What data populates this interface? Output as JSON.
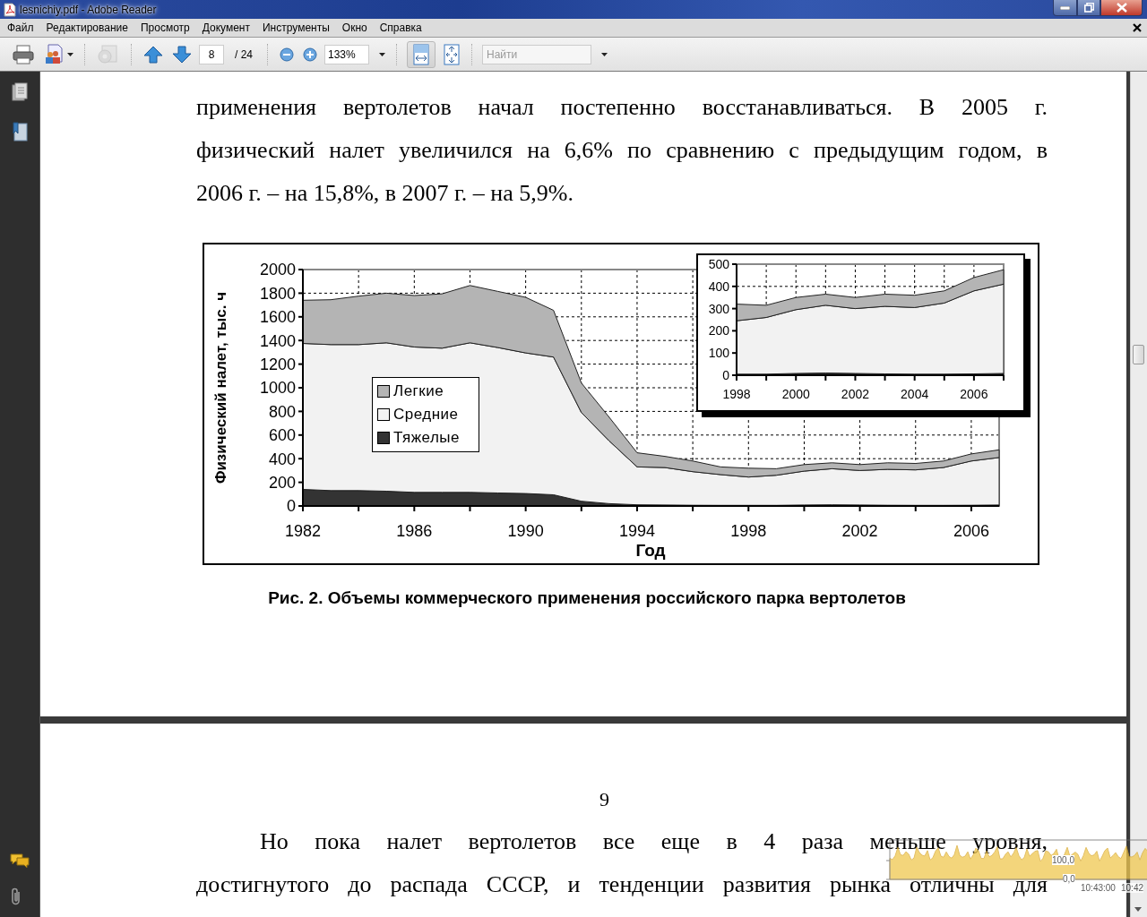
{
  "window": {
    "title": "lesnichiy.pdf - Adobe Reader"
  },
  "menu": [
    "Файл",
    "Редактирование",
    "Просмотр",
    "Документ",
    "Инструменты",
    "Окно",
    "Справка"
  ],
  "toolbar": {
    "items": [
      {
        "kind": "print",
        "disabled": false
      },
      {
        "kind": "create",
        "disabled": false,
        "dropdown": true
      },
      {
        "kind": "separator"
      },
      {
        "kind": "share",
        "disabled": true
      },
      {
        "kind": "separator"
      },
      {
        "kind": "prev",
        "disabled": false
      },
      {
        "kind": "next",
        "disabled": false
      },
      {
        "kind": "page",
        "value": "8",
        "total": "/ 24"
      },
      {
        "kind": "separator"
      },
      {
        "kind": "zoom-out",
        "disabled": false
      },
      {
        "kind": "zoom-in",
        "disabled": false
      },
      {
        "kind": "zoom",
        "value": "133%"
      },
      {
        "kind": "separator"
      },
      {
        "kind": "fit-width",
        "selected": true
      },
      {
        "kind": "fit-page",
        "selected": false
      },
      {
        "kind": "separator"
      },
      {
        "kind": "find",
        "placeholder": "Найти"
      }
    ]
  },
  "sidebar": {
    "top_tools": [
      {
        "kind": "pages"
      },
      {
        "kind": "bookmarks"
      }
    ],
    "bottom_tools": [
      {
        "kind": "comments"
      },
      {
        "kind": "attachments"
      }
    ]
  },
  "pages": [
    {
      "paragraph": {
        "first_line_indent": false,
        "ends": true,
        "lines": [
          "применения вертолетов начал постепенно восстанавливаться. В 2005 г.",
          "физический налет увеличился на 6,6% по сравнению с предыдущим годом, в",
          "2006 г. – на 15,8%, в 2007 г. – на 5,9%."
        ]
      },
      "figure": {
        "chart_data": {
          "type": "area",
          "stacked": true,
          "grid": true,
          "xlabel": "Год",
          "ylabel": "Физический налет, тыс. ч",
          "x": [
            1982,
            1983,
            1984,
            1985,
            1986,
            1987,
            1988,
            1989,
            1990,
            1991,
            1992,
            1993,
            1994,
            1995,
            1996,
            1997,
            1998,
            1999,
            2000,
            2001,
            2002,
            2003,
            2004,
            2005,
            2006,
            2007
          ],
          "xlim": [
            1982,
            2007
          ],
          "ylim": [
            0,
            2000
          ],
          "xticks": [
            1982,
            1986,
            1990,
            1994,
            1998,
            2002,
            2006
          ],
          "yticks": [
            0,
            200,
            400,
            600,
            800,
            1000,
            1200,
            1400,
            1600,
            1800,
            2000
          ],
          "series": [
            {
              "name": "Легкие",
              "color": "#b4b4b4",
              "values": [
                365,
                380,
                410,
                420,
                435,
                460,
                485,
                475,
                470,
                395,
                250,
                200,
                120,
                95,
                90,
                65,
                75,
                55,
                55,
                50,
                50,
                55,
                55,
                55,
                60,
                65
              ]
            },
            {
              "name": "Средние",
              "color": "#f2f2f2",
              "values": [
                1235,
                1235,
                1235,
                1255,
                1230,
                1220,
                1265,
                1230,
                1190,
                1165,
                750,
                530,
                320,
                317,
                284,
                260,
                240,
                255,
                287,
                305,
                292,
                304,
                300,
                320,
                374,
                402
              ]
            },
            {
              "name": "Тяжелые",
              "color": "#333333",
              "values": [
                140,
                130,
                130,
                125,
                115,
                115,
                115,
                110,
                105,
                95,
                40,
                20,
                10,
                8,
                6,
                5,
                5,
                5,
                8,
                10,
                8,
                6,
                5,
                5,
                6,
                8
              ]
            }
          ]
        },
        "inset": {
          "chart_data": {
            "type": "area",
            "stacked": true,
            "grid": true,
            "x": [
              1998,
              1999,
              2000,
              2001,
              2002,
              2003,
              2004,
              2005,
              2006,
              2007
            ],
            "xlim": [
              1998,
              2007
            ],
            "ylim": [
              0,
              500
            ],
            "xticks": [
              1998,
              2000,
              2002,
              2004,
              2006
            ],
            "yticks": [
              0,
              100,
              200,
              300,
              400,
              500
            ],
            "series": [
              {
                "color": "#b4b4b4",
                "values": [
                  75,
                  55,
                  55,
                  50,
                  50,
                  55,
                  55,
                  55,
                  60,
                  65
                ]
              },
              {
                "color": "#f2f2f2",
                "values": [
                  240,
                  255,
                  287,
                  305,
                  292,
                  304,
                  300,
                  320,
                  374,
                  402
                ]
              },
              {
                "color": "#333333",
                "values": [
                  5,
                  5,
                  8,
                  10,
                  8,
                  6,
                  5,
                  5,
                  6,
                  8
                ]
              }
            ]
          }
        }
      },
      "caption": "Рис. 2. Объемы коммерческого применения российского парка вертолетов"
    },
    {
      "page_number": "9",
      "paragraph": {
        "first_line_indent": true,
        "ends": false,
        "lines": [
          "Но пока налет вертолетов все еще в 4 раза меньше уровня,",
          "достигнутого до распада СССР, и тенденции развития рынка отличны для"
        ]
      }
    }
  ],
  "overlay_graph": {
    "y_labels": [
      "100,0",
      "0,0"
    ],
    "x_labels": [
      "10:43:00",
      "10:42"
    ]
  }
}
